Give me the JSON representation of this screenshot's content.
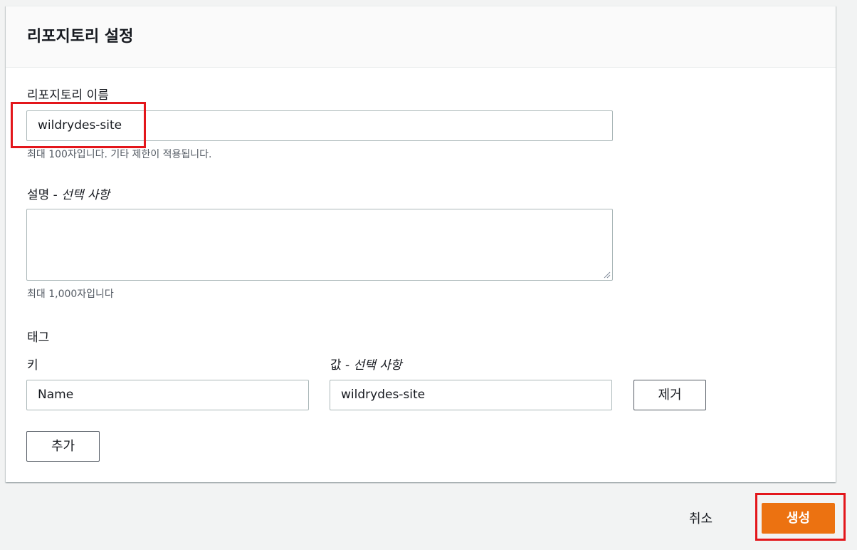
{
  "panel": {
    "title": "리포지토리 설정"
  },
  "repo_name": {
    "label": "리포지토리 이름",
    "value": "wildrydes-site",
    "hint": "최대 100자입니다. 기타 제한이 적용됩니다."
  },
  "description": {
    "label": "설명 - ",
    "label_optional": "선택 사항",
    "value": "",
    "hint": "최대 1,000자입니다"
  },
  "tags": {
    "heading": "태그",
    "key_label": "키",
    "value_label": "값 - ",
    "value_label_optional": "선택 사항",
    "key_value": "Name",
    "tag_value": "wildrydes-site",
    "remove_label": "제거",
    "add_label": "추가"
  },
  "footer": {
    "cancel_label": "취소",
    "create_label": "생성"
  },
  "colors": {
    "primary": "#ec7211",
    "highlight": "#e3161b"
  }
}
